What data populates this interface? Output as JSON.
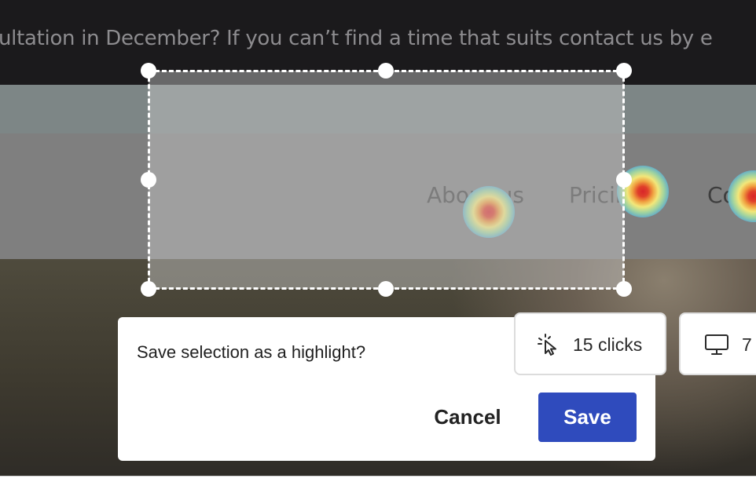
{
  "banner": {
    "text": "ultation in December? If you can’t find a time that suits contact us by e"
  },
  "nav": {
    "items": [
      {
        "label": "About us"
      },
      {
        "label": "Pricing"
      },
      {
        "label": "Co"
      }
    ],
    "pricing_icon": "chevron-down-icon"
  },
  "dialog": {
    "question": "Save selection as a highlight?",
    "cancel_label": "Cancel",
    "save_label": "Save"
  },
  "stats": {
    "clicks": {
      "icon": "cursor-click-icon",
      "label": "15 clicks"
    },
    "device": {
      "icon": "desktop-icon",
      "label": "7"
    }
  },
  "colors": {
    "banner_bg": "#1b1a1c",
    "overlay_nav": "#7f7f7f",
    "save_button": "#2f4bbd",
    "selection_border": "#ffffff"
  }
}
